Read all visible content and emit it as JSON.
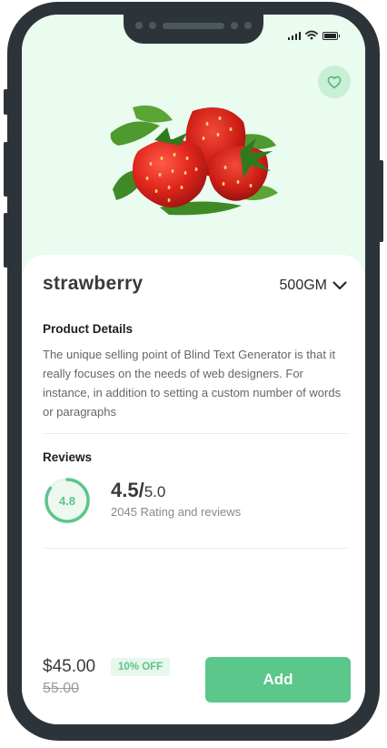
{
  "product": {
    "name": "strawberry",
    "weight": "500GM",
    "image_icon": "strawberry-image"
  },
  "details": {
    "heading": "Product Details",
    "description": "The unique selling point of Blind Text Generator is that it really focuses on the needs of web designers. For instance, in addition to setting a custom number of words or paragraphs"
  },
  "reviews": {
    "heading": "Reviews",
    "ring_value": "4.8",
    "ring_fraction": 0.85,
    "score": "4.5",
    "separator": "/",
    "max": "5.0",
    "summary": "2045 Rating and reviews"
  },
  "purchase": {
    "price": "$45.00",
    "old_price": "55.00",
    "discount": "10% OFF",
    "add_label": "Add"
  },
  "colors": {
    "accent": "#5bc78b",
    "hero_background": "#eafbf0",
    "frame": "#2c3439"
  },
  "icons": {
    "favorite": "heart-icon",
    "weight_dropdown": "chevron-down-icon",
    "signal": "signal-icon",
    "wifi": "wifi-icon",
    "battery": "battery-icon"
  }
}
